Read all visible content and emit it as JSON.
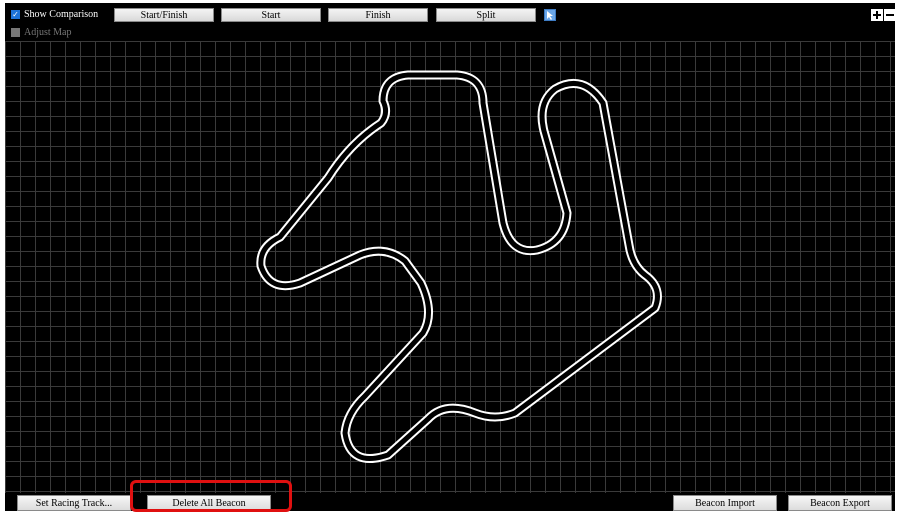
{
  "toolbar": {
    "show_comparison": {
      "label": "Show Comparison",
      "checked": true
    },
    "adjust_map": {
      "label": "Adjust Map",
      "checked": false,
      "enabled": false
    },
    "buttons": {
      "start_finish": "Start/Finish",
      "start": "Start",
      "finish": "Finish",
      "split": "Split"
    },
    "cursor_tool_icon": "cursor-icon",
    "zoom_in_icon": "plus-icon",
    "zoom_out_icon": "minus-icon"
  },
  "map": {
    "background_color": "#000000",
    "grid_color": "#3a3a3a",
    "track_color": "#ffffff"
  },
  "bottom": {
    "set_racing_track": "Set Racing Track...",
    "delete_all_beacon": "Delete All Beacon",
    "beacon_import": "Beacon Import",
    "beacon_export": "Beacon Export"
  },
  "highlight_color": "#e01010"
}
